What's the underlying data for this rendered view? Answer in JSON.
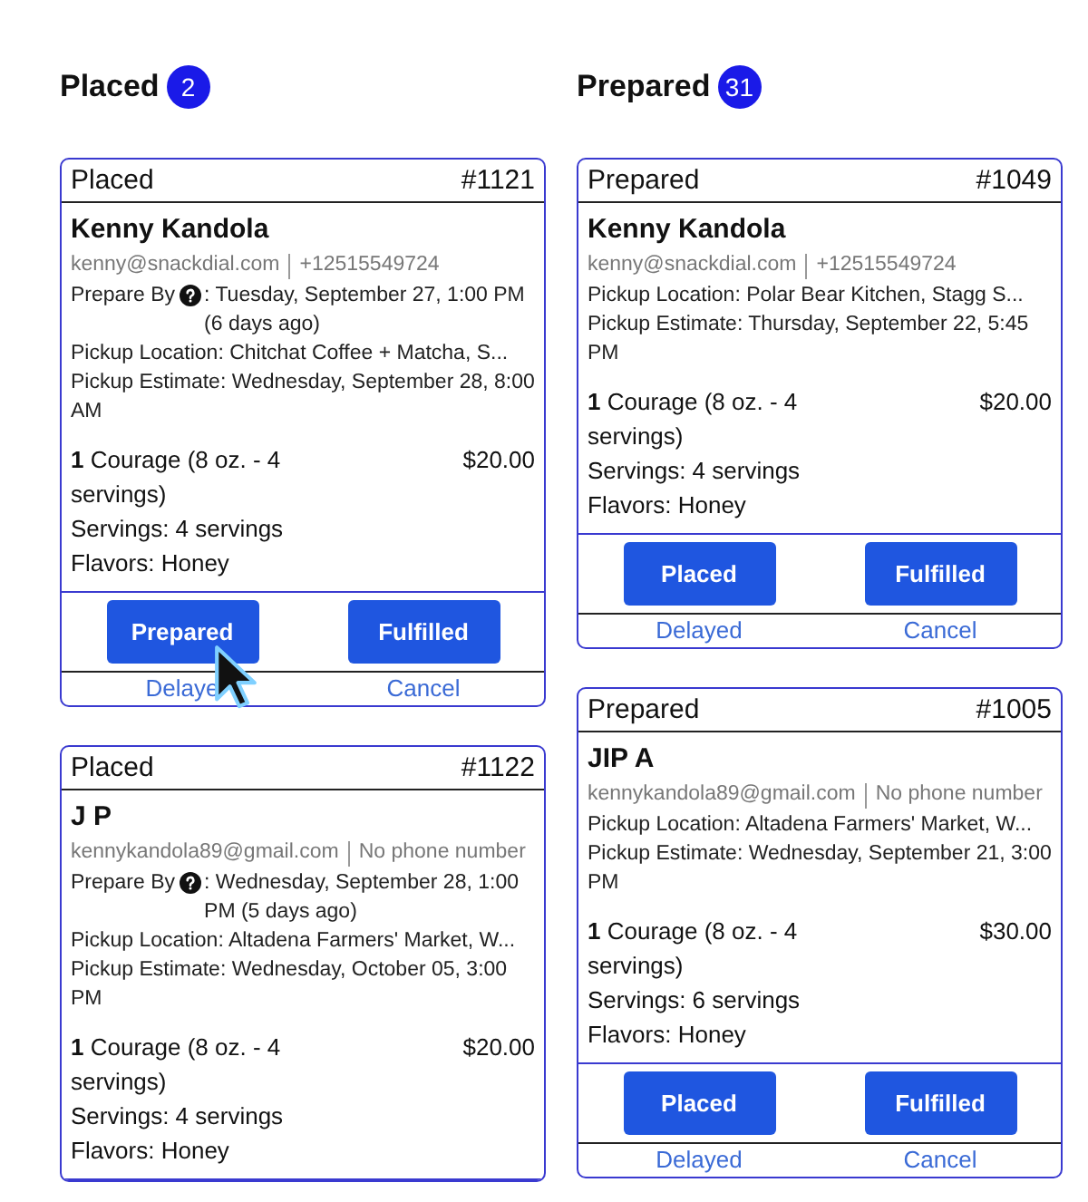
{
  "columns": [
    {
      "title": "Placed",
      "count": "2",
      "orders": [
        {
          "status": "Placed",
          "number": "#1121",
          "customer": "Kenny Kandola",
          "email": "kenny@snackdial.com",
          "phone": "+12515549724",
          "prepare_by": {
            "label": "Prepare By",
            "value": ": Tuesday, September 27, 1:00 PM (6 days ago)"
          },
          "pickup_location": "Pickup Location: Chitchat Coffee + Matcha, S...",
          "pickup_estimate": "Pickup Estimate: Wednesday, September 28, 8:00 AM",
          "item": {
            "quantity": "1",
            "name": "Courage (8 oz. - 4 servings)",
            "price": "$20.00",
            "servings": "Servings: 4 servings",
            "flavors": "Flavors: Honey"
          },
          "buttons": [
            {
              "label": "Prepared"
            },
            {
              "label": "Fulfilled"
            }
          ],
          "links": [
            "Delaye",
            "Cancel"
          ]
        },
        {
          "status": "Placed",
          "number": "#1122",
          "customer": "J P",
          "email": "kennykandola89@gmail.com",
          "phone": "No phone number",
          "prepare_by": {
            "label": "Prepare By",
            "value": ": Wednesday, September 28, 1:00 PM (5 days ago)"
          },
          "pickup_location": "Pickup Location: Altadena Farmers' Market, W...",
          "pickup_estimate": "Pickup Estimate: Wednesday, October 05, 3:00 PM",
          "item": {
            "quantity": "1",
            "name": "Courage (8 oz. - 4 servings)",
            "price": "$20.00",
            "servings": "Servings: 4 servings",
            "flavors": "Flavors: Honey"
          }
        }
      ]
    },
    {
      "title": "Prepared",
      "count": "31",
      "orders": [
        {
          "status": "Prepared",
          "number": "#1049",
          "customer": "Kenny Kandola",
          "email": "kenny@snackdial.com",
          "phone": "+12515549724",
          "pickup_location": "Pickup Location: Polar Bear Kitchen, Stagg S...",
          "pickup_estimate": "Pickup Estimate: Thursday, September 22, 5:45 PM",
          "item": {
            "quantity": "1",
            "name": "Courage (8 oz. - 4 servings)",
            "price": "$20.00",
            "servings": "Servings: 4 servings",
            "flavors": "Flavors: Honey"
          },
          "buttons": [
            {
              "label": "Placed"
            },
            {
              "label": "Fulfilled"
            }
          ],
          "links": [
            "Delayed",
            "Cancel"
          ]
        },
        {
          "status": "Prepared",
          "number": "#1005",
          "customer": "JIP A",
          "email": "kennykandola89@gmail.com",
          "phone": "No phone number",
          "pickup_location": "Pickup Location: Altadena Farmers' Market, W...",
          "pickup_estimate": "Pickup Estimate: Wednesday, September 21, 3:00 PM",
          "item": {
            "quantity": "1",
            "name": "Courage (8 oz. - 4 servings)",
            "price": "$30.00",
            "servings": "Servings: 6 servings",
            "flavors": "Flavors: Honey"
          },
          "buttons": [
            {
              "label": "Placed"
            },
            {
              "label": "Fulfilled"
            }
          ],
          "links": [
            "Delayed",
            "Cancel"
          ]
        }
      ]
    }
  ]
}
